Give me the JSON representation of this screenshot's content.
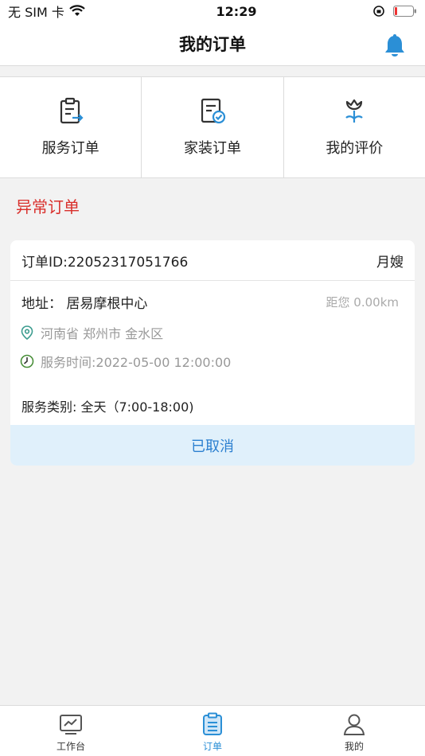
{
  "status_bar": {
    "carrier": "无 SIM 卡",
    "time": "12:29"
  },
  "header": {
    "title": "我的订单"
  },
  "menu": [
    {
      "label": "服务订单",
      "icon": "service-order-icon"
    },
    {
      "label": "家装订单",
      "icon": "home-decor-order-icon"
    },
    {
      "label": "我的评价",
      "icon": "review-icon"
    }
  ],
  "section": {
    "title": "异常订单"
  },
  "order": {
    "id_text": "订单ID:22052317051766",
    "type": "月嫂",
    "address": "地址：  居易摩根中心",
    "distance": "距您 0.00km",
    "region": "河南省 郑州市 金水区",
    "service_time": "服务时间:2022-05-00 12:00:00",
    "category": "服务类别: 全天（7:00-18:00)",
    "status": "已取消"
  },
  "tabs": [
    {
      "label": "工作台",
      "icon": "workbench-icon"
    },
    {
      "label": "订单",
      "icon": "orders-icon",
      "active": true
    },
    {
      "label": "我的",
      "icon": "profile-icon"
    }
  ],
  "colors": {
    "accent": "#2b8fd6",
    "alert": "#d9302c",
    "status_bg": "#e0f0fb"
  }
}
